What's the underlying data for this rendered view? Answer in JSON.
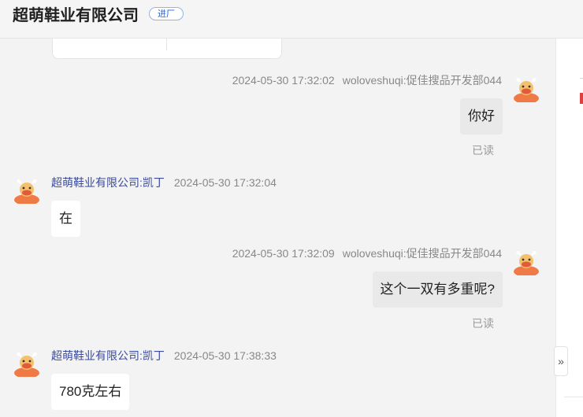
{
  "header": {
    "title": "超萌鞋业有限公司",
    "badge": "进厂"
  },
  "messages": [
    {
      "side": "right",
      "time": "2024-05-30 17:32:02",
      "sender": "woloveshuqi:促佳搜品开发部044",
      "text": "你好",
      "status": "已读"
    },
    {
      "side": "left",
      "sender": "超萌鞋业有限公司:凯丁",
      "time": "2024-05-30 17:32:04",
      "text": "在"
    },
    {
      "side": "right",
      "time": "2024-05-30 17:32:09",
      "sender": "woloveshuqi:促佳搜品开发部044",
      "text": "这个一双有多重呢?",
      "status": "已读"
    },
    {
      "side": "left",
      "sender": "超萌鞋业有限公司:凯丁",
      "time": "2024-05-30 17:38:33",
      "text": "780克左右"
    }
  ],
  "collapse_icon": "double-chevron-right-icon",
  "colors": {
    "accent": "#2a64c8",
    "left_name": "#3a4a9c",
    "avatar": "#f07a45"
  }
}
